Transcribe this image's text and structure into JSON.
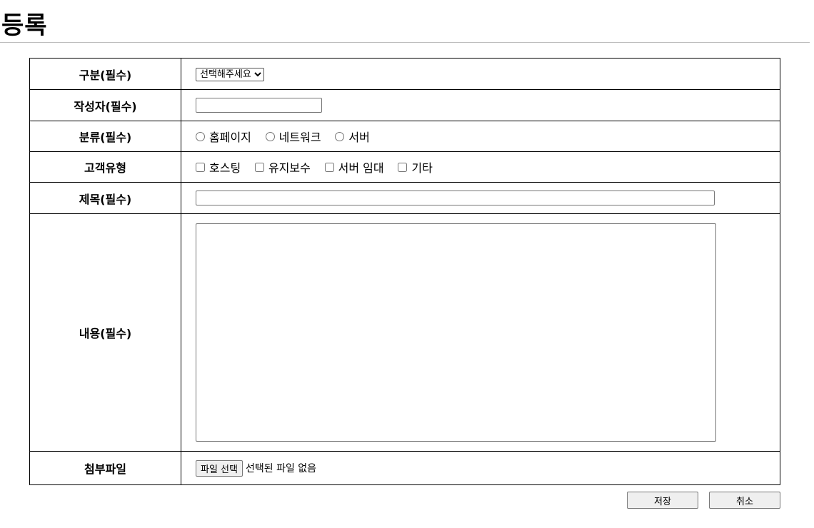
{
  "page": {
    "title": "등록"
  },
  "form": {
    "category": {
      "label": "구분(필수)",
      "selected": "선택해주세요"
    },
    "author": {
      "label": "작성자(필수)",
      "value": ""
    },
    "type": {
      "label": "분류(필수)",
      "options": [
        "홈페이지",
        "네트워크",
        "서버"
      ]
    },
    "customer": {
      "label": "고객유형",
      "options": [
        "호스팅",
        "유지보수",
        "서버 임대",
        "기타"
      ]
    },
    "subject": {
      "label": "제목(필수)",
      "value": ""
    },
    "content": {
      "label": "내용(필수)",
      "value": ""
    },
    "attachment": {
      "label": "첨부파일",
      "button": "파일 선택",
      "status": "선택된 파일 없음"
    }
  },
  "actions": {
    "save": "저장",
    "cancel": "취소"
  }
}
